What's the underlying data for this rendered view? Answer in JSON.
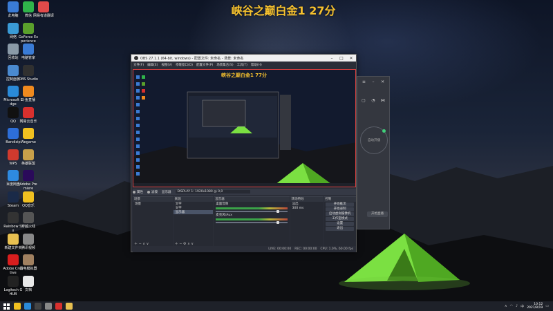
{
  "overlay": {
    "title": "峡谷之巅白金1 27分"
  },
  "colors": {
    "accent_title": "#f6c12e",
    "preview_border": "#d94040",
    "indicator_green": "#3fd07a"
  },
  "desktop_icons": [
    {
      "label": "此电脑",
      "icon": "computer-icon",
      "color": "#3a7bd5"
    },
    {
      "label": "微信",
      "icon": "wechat-icon",
      "color": "#2fb34a"
    },
    {
      "label": "网易有道翻译",
      "icon": "translate-icon",
      "color": "#e04a4a"
    },
    {
      "label": "网络",
      "icon": "network-icon",
      "color": "#3a9ad5"
    },
    {
      "label": "GeForce Experience",
      "icon": "nvidia-icon",
      "color": "#5aa02c"
    },
    {
      "label": "回收站",
      "icon": "recycle-bin-icon",
      "color": "#8a9aa8"
    },
    {
      "label": "电脑管家",
      "icon": "shield-icon",
      "color": "#3a7bd5"
    },
    {
      "label": "控制面板",
      "icon": "control-panel-icon",
      "color": "#4a8ad0"
    },
    {
      "label": "OBS Studio",
      "icon": "obs-icon",
      "color": "#303030"
    },
    {
      "label": "Microsoft Edge",
      "icon": "edge-icon",
      "color": "#2a8ad8"
    },
    {
      "label": "斗鱼直播",
      "icon": "douyu-icon",
      "color": "#f08a1e"
    },
    {
      "label": "QQ",
      "icon": "qq-icon",
      "color": "#111111"
    },
    {
      "label": "网易云音乐",
      "icon": "music-icon",
      "color": "#d8302e"
    },
    {
      "label": "Bandizip",
      "icon": "zip-icon",
      "color": "#2d6ed8"
    },
    {
      "label": "Wegame",
      "icon": "wegame-icon",
      "color": "#f0c020"
    },
    {
      "label": "WPS",
      "icon": "wps-icon",
      "color": "#d03a2e"
    },
    {
      "label": "英雄联盟",
      "icon": "game-icon",
      "color": "#c8a04a"
    },
    {
      "label": "百度网盘",
      "icon": "cloud-icon",
      "color": "#2e8ae0"
    },
    {
      "label": "Adobe Premiere",
      "icon": "premiere-icon",
      "color": "#2a0a5a"
    },
    {
      "label": "Steam",
      "icon": "steam-icon",
      "color": "#1a2a48"
    },
    {
      "label": "QQ音乐",
      "icon": "qq-music-icon",
      "color": "#f0c020"
    },
    {
      "label": "Rainbow Six",
      "icon": "r6-icon",
      "color": "#333333"
    },
    {
      "label": "穿越火线",
      "icon": "cf-icon",
      "color": "#555555"
    },
    {
      "label": "新建文件夹",
      "icon": "folder-icon",
      "color": "#e8c050"
    },
    {
      "label": "腾讯视频",
      "icon": "video-icon",
      "color": "#888888"
    },
    {
      "label": "Adobe Creative",
      "icon": "adobe-icon",
      "color": "#d81e1e"
    },
    {
      "label": "雷电模拟器",
      "icon": "emulator-icon",
      "color": "#a08060"
    },
    {
      "label": "Logitech G HUB",
      "icon": "logitech-icon",
      "color": "#222222"
    },
    {
      "label": "文档",
      "icon": "document-icon",
      "color": "#e8e8e8"
    }
  ],
  "obs": {
    "window_title": "OBS 27.1.1 (64-bit, windows) - 配置文件: 未命名 - 场景: 未命名",
    "menus": [
      "文件(F)",
      "编辑(E)",
      "视图(V)",
      "停靠窗口(D)",
      "配置文件(P)",
      "场景集合(S)",
      "工具(T)",
      "帮助(H)"
    ],
    "preview_title": "峡谷之巅白金1 77分",
    "toolbar": {
      "properties": "属性",
      "filters": "滤镜",
      "source_label": "显示器",
      "display_value": "DISPLAY 1: 1920x1080 @ 0,0"
    },
    "scenes": {
      "title": "场景",
      "items": [
        "场景"
      ]
    },
    "sources": {
      "title": "来源",
      "items": [
        "文字",
        "文字",
        "显示器"
      ]
    },
    "mixer": {
      "title": "混音器",
      "channels": [
        "桌面音频",
        "麦克风/Aux"
      ]
    },
    "transitions": {
      "title": "转场特效",
      "type": "淡出",
      "duration": "300 ms"
    },
    "controls": {
      "title": "控制",
      "buttons": [
        "开始推流",
        "开始录制",
        "启动虚拟摄像机",
        "工作室模式",
        "设置",
        "退出"
      ]
    },
    "status": {
      "live": "LIVE: 00:00:00",
      "rec": "REC: 00:00:00",
      "cpu": "CPU: 1.0%, 60.00 fps"
    }
  },
  "side_panel": {
    "center_label": "自动开播",
    "button_label": "开始直播"
  },
  "taskbar": {
    "time": "10:12",
    "date": "2021/8/19",
    "ime": "中"
  }
}
